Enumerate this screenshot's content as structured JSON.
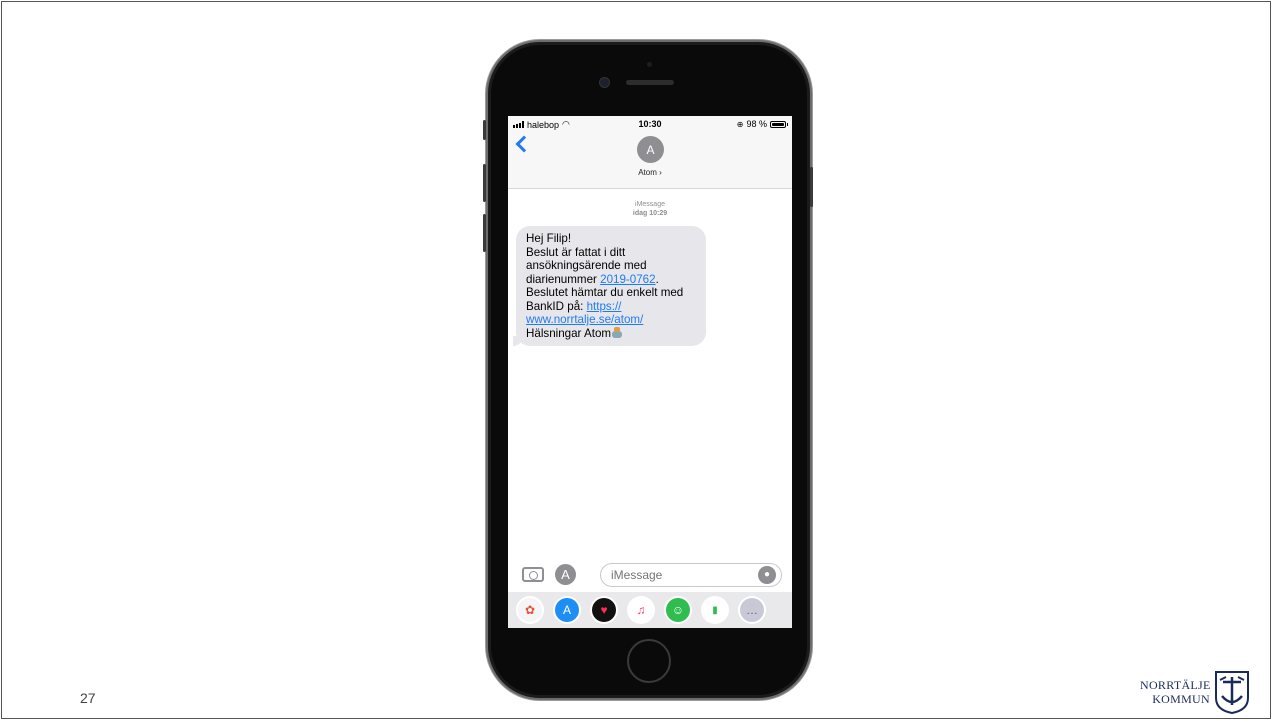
{
  "slide": {
    "page_number": "27"
  },
  "status_bar": {
    "carrier": "halebop",
    "time": "10:30",
    "battery": "98 %"
  },
  "header": {
    "contact_initial": "A",
    "contact_name": "Atom ›"
  },
  "conversation": {
    "service": "iMessage",
    "timestamp": "idag 10:29",
    "message": {
      "line1": "Hej Filip!",
      "line2": "Beslut är fattat i ditt",
      "line3": "ansökningsärende med",
      "line4": "diarienummer",
      "case_number_link": "2019-0762",
      "line4_end": ".",
      "line5": "Beslutet hämtar du enkelt med",
      "line6": "BankID på:",
      "url_part1": "https://",
      "url_part2": "www.norrtalje.se/atom/",
      "line8": "Hälsningar Atom"
    }
  },
  "input_bar": {
    "placeholder": "iMessage"
  },
  "app_drawer": {
    "apps": [
      {
        "name": "photos",
        "color": "#f5f5f5"
      },
      {
        "name": "app-store",
        "color": "#1c8ef5"
      },
      {
        "name": "digital-touch",
        "color": "#111111"
      },
      {
        "name": "music",
        "color": "#ffffff"
      },
      {
        "name": "messages-app",
        "color": "#2fbd4f"
      },
      {
        "name": "stats",
        "color": "#ffffff"
      }
    ]
  },
  "logo": {
    "line1": "NORRTÄLJE",
    "line2": "KOMMUN"
  }
}
